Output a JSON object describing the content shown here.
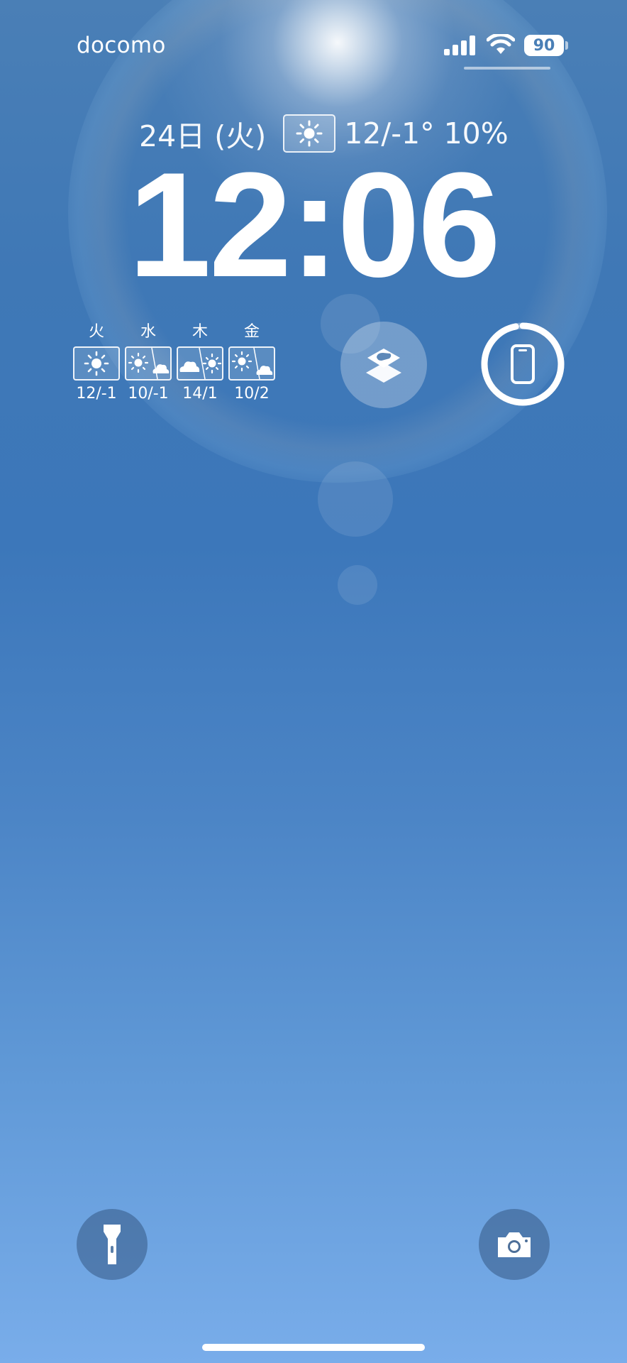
{
  "status_bar": {
    "carrier": "docomo",
    "battery_level": "90",
    "icons": [
      "cellular-signal-icon",
      "wifi-icon",
      "battery-icon"
    ]
  },
  "lock_screen": {
    "date_line": {
      "date": "24日 (火)",
      "weather_icon": "sun-icon",
      "weather": "12/-1° 10%"
    },
    "time": "12:06"
  },
  "forecast_widget": {
    "days": [
      {
        "day": "火",
        "icon": "sunny",
        "temp": "12/-1"
      },
      {
        "day": "水",
        "icon": "sunny-then-cloudy",
        "temp": "10/-1"
      },
      {
        "day": "木",
        "icon": "cloudy-then-sunny",
        "temp": "14/1"
      },
      {
        "day": "金",
        "icon": "sunny-then-cloudy",
        "temp": "10/2"
      }
    ]
  },
  "widgets": {
    "shortcuts": {
      "icon": "shortcuts-icon"
    },
    "device_battery": {
      "icon": "iphone-icon",
      "ring_fraction": 0.97
    }
  },
  "controls": {
    "flashlight": {
      "icon": "flashlight-icon"
    },
    "camera": {
      "icon": "camera-icon"
    }
  },
  "colors": {
    "sky_top": "#4a7fb6",
    "sky_bottom": "#79adea",
    "text": "#ffffff"
  }
}
